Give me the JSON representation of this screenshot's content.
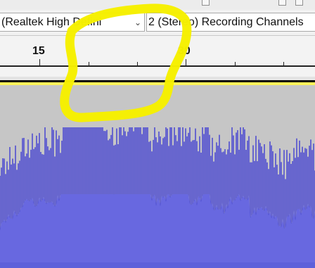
{
  "toolbar": {
    "recording_device": "(Realtek High Defini",
    "recording_channels": "2 (Stereo) Recording Channels",
    "dropdown_icon": "chevron-down-icon"
  },
  "timeline": {
    "labels": [
      "15",
      "30"
    ]
  },
  "colors": {
    "waveform": "#3f3ed1",
    "waveform_light": "#6869e5",
    "background": "#c6c6c6",
    "highlight": "#f7f000"
  }
}
